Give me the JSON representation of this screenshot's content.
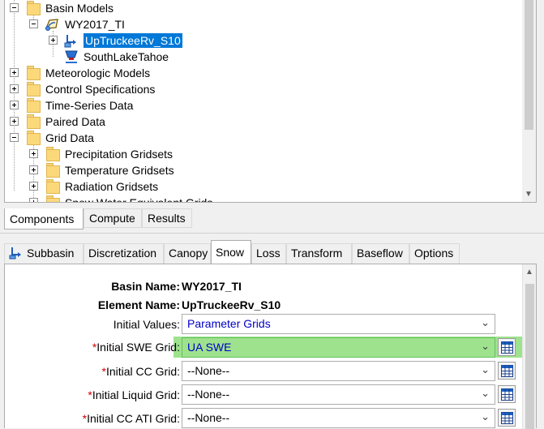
{
  "tree": {
    "items": [
      {
        "label": "Basin Models",
        "kind": "folder",
        "expanded": true
      },
      {
        "label": "WY2017_TI",
        "kind": "basin",
        "expanded": true
      },
      {
        "label": "UpTruckeeRv_S10",
        "kind": "subbasin",
        "selected": true
      },
      {
        "label": "SouthLakeTahoe",
        "kind": "reservoir"
      },
      {
        "label": "Meteorologic Models",
        "kind": "folder"
      },
      {
        "label": "Control Specifications",
        "kind": "folder"
      },
      {
        "label": "Time-Series Data",
        "kind": "folder"
      },
      {
        "label": "Paired Data",
        "kind": "folder"
      },
      {
        "label": "Grid Data",
        "kind": "folder",
        "expanded": true
      },
      {
        "label": "Precipitation Gridsets",
        "kind": "folder"
      },
      {
        "label": "Temperature Gridsets",
        "kind": "folder"
      },
      {
        "label": "Radiation Gridsets",
        "kind": "folder"
      },
      {
        "label": "Snow Water Equivalent Grids",
        "kind": "folder"
      }
    ]
  },
  "component_tabs": [
    "Components",
    "Compute",
    "Results"
  ],
  "component_tabs_active": "Components",
  "editor_tabs": [
    "Subbasin",
    "Discretization",
    "Canopy",
    "Snow",
    "Loss",
    "Transform",
    "Baseflow",
    "Options"
  ],
  "editor_tabs_active": "Snow",
  "form": {
    "basin_name_label": "Basin Name:",
    "basin_name_value": "WY2017_TI",
    "element_name_label": "Element Name:",
    "element_name_value": "UpTruckeeRv_S10",
    "initial_values_label": "Initial Values:",
    "initial_values_value": "Parameter Grids",
    "required_marker": "*",
    "swe_grid_label": "Initial SWE Grid:",
    "swe_grid_value": "UA SWE",
    "cc_grid_label": "Initial CC Grid:",
    "cc_grid_value": "--None--",
    "liquid_grid_label": "Initial Liquid Grid:",
    "liquid_grid_value": "--None--",
    "cc_ati_grid_label": "Initial CC ATI Grid:",
    "cc_ati_grid_value": "--None--"
  },
  "colors": {
    "selection": "#0078d7",
    "highlight": "#9ee28e",
    "required": "#d00000",
    "link_value": "#0000c8"
  }
}
